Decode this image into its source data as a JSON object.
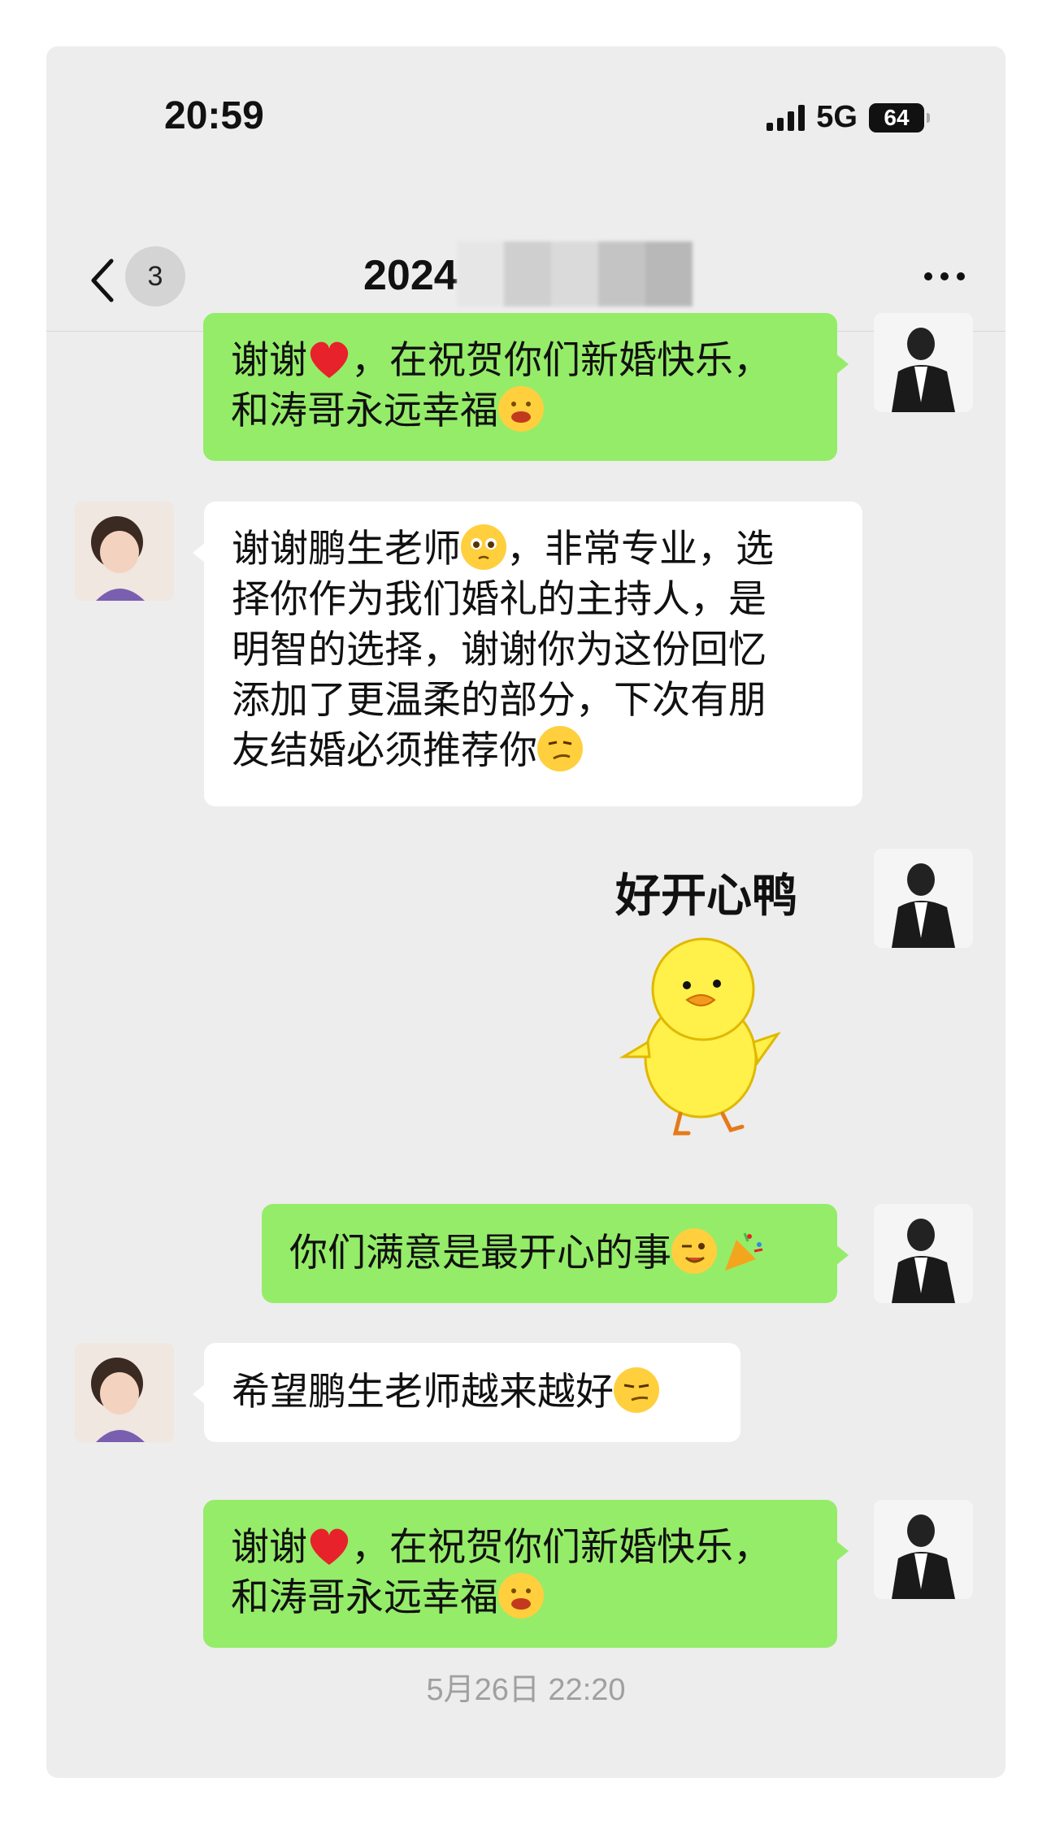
{
  "status_bar": {
    "time": "20:59",
    "network": "5G",
    "battery": "64"
  },
  "nav": {
    "unread_count": "3",
    "title": "2024"
  },
  "messages": [
    {
      "sender": "me",
      "text": "谢谢❤️，在祝贺你们新婚快乐，和涛哥永远幸福",
      "parts": [
        "谢谢",
        "，在祝贺你们新婚快乐，",
        "和涛哥永远幸福"
      ]
    },
    {
      "sender": "them",
      "parts": [
        "谢谢鹏生老师",
        "，非常专业，选",
        "择你作为我们婚礼的主持人，是",
        "明智的选择，谢谢你为这份回忆",
        "添加了更温柔的部分，下次有朋",
        "友结婚必须推荐你"
      ]
    },
    {
      "sender": "me",
      "type": "sticker",
      "caption": "好开心鸭",
      "icon": "yellow-duck-sticker"
    },
    {
      "sender": "me",
      "parts": [
        "你们满意是最开心的事"
      ]
    },
    {
      "sender": "them",
      "parts": [
        "希望鹏生老师越来越好"
      ]
    },
    {
      "sender": "me",
      "parts": [
        "谢谢",
        "，在祝贺你们新婚快乐，",
        "和涛哥永远幸福"
      ]
    }
  ],
  "timestamp": "5月26日 22:20",
  "colors": {
    "background": "#ededed",
    "my_bubble": "#95ec69",
    "their_bubble": "#ffffff"
  }
}
